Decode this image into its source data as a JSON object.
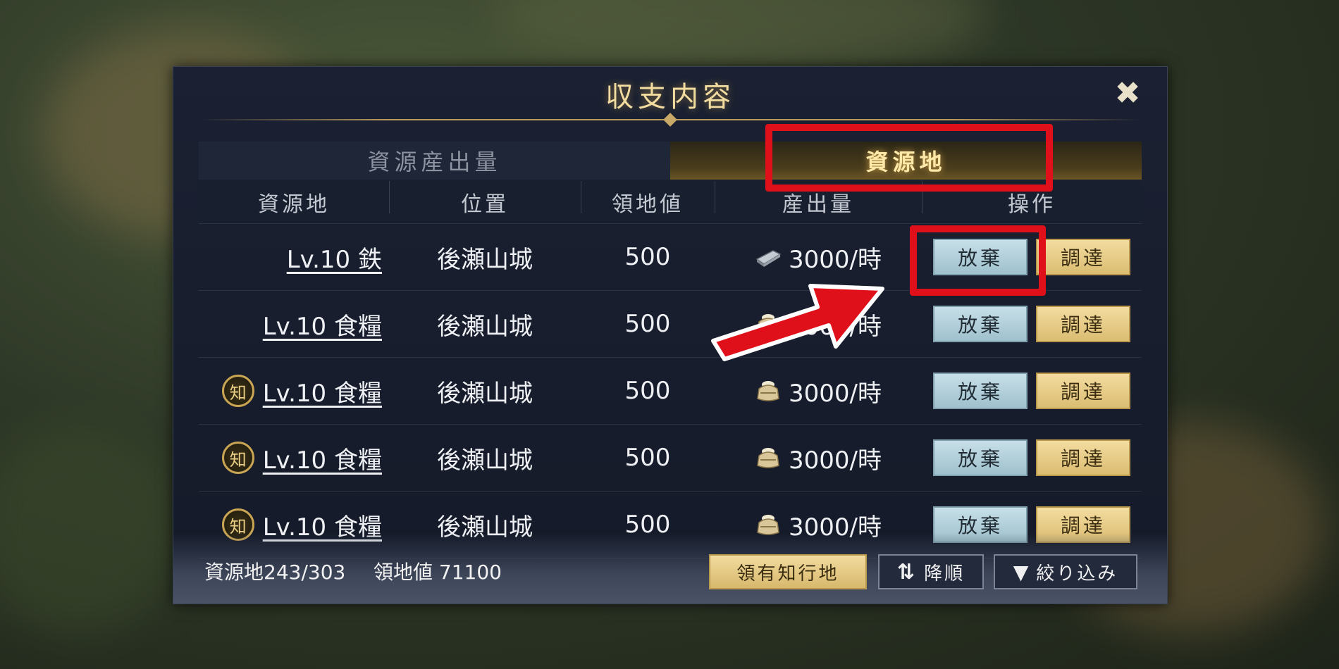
{
  "window": {
    "title": "収支内容",
    "close_icon": "close-shuriken-icon"
  },
  "tabs": [
    {
      "label": "資源産出量",
      "active": false
    },
    {
      "label": "資源地",
      "active": true
    }
  ],
  "table": {
    "headers": [
      "資源地",
      "位置",
      "領地値",
      "産出量",
      "操作"
    ],
    "rows": [
      {
        "badge": "",
        "name": "Lv.10 鉄",
        "location": "後瀬山城",
        "value": "500",
        "resource_icon": "iron-ingot-icon",
        "output": "3000/時",
        "abandon": "放棄",
        "procure": "調達"
      },
      {
        "badge": "",
        "name": "Lv.10 食糧",
        "location": "後瀬山城",
        "value": "500",
        "resource_icon": "rice-bag-icon",
        "output": "3000/時",
        "abandon": "放棄",
        "procure": "調達"
      },
      {
        "badge": "知",
        "name": "Lv.10 食糧",
        "location": "後瀬山城",
        "value": "500",
        "resource_icon": "rice-bag-icon",
        "output": "3000/時",
        "abandon": "放棄",
        "procure": "調達"
      },
      {
        "badge": "知",
        "name": "Lv.10 食糧",
        "location": "後瀬山城",
        "value": "500",
        "resource_icon": "rice-bag-icon",
        "output": "3000/時",
        "abandon": "放棄",
        "procure": "調達"
      },
      {
        "badge": "知",
        "name": "Lv.10 食糧",
        "location": "後瀬山城",
        "value": "500",
        "resource_icon": "rice-bag-icon",
        "output": "3000/時",
        "abandon": "放棄",
        "procure": "調達"
      }
    ]
  },
  "footer": {
    "resource_count": "資源地243/303",
    "territory_value": "領地値 71100",
    "fief_button": "領有知行地",
    "sort_button": "降順",
    "filter_button": "絞り込み"
  },
  "colors": {
    "highlight": "#e0101a",
    "accent_gold": "#f3dc9f",
    "panel_bg": "#1b2132"
  }
}
